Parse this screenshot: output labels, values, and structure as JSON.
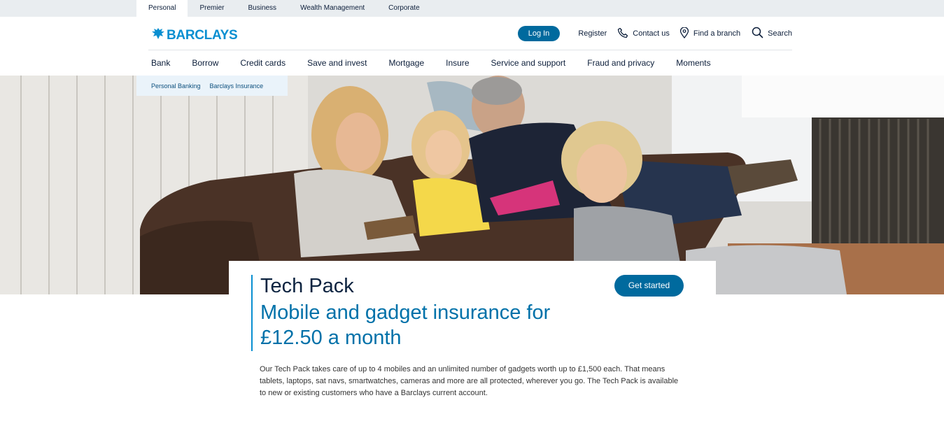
{
  "segments": [
    "Personal",
    "Premier",
    "Business",
    "Wealth Management",
    "Corporate"
  ],
  "brand": {
    "name": "BARCLAYS",
    "logo_icon": "eagle-icon",
    "color": "#0a8fd1"
  },
  "header": {
    "login_label": "Log In",
    "register_label": "Register",
    "contact_label": "Contact us",
    "branch_label": "Find a branch",
    "search_label": "Search"
  },
  "nav": [
    "Bank",
    "Borrow",
    "Credit cards",
    "Save and invest",
    "Mortgage",
    "Insure",
    "Service and support",
    "Fraud and privacy",
    "Moments"
  ],
  "subnav": [
    "Personal Banking",
    "Barclays Insurance"
  ],
  "hero": {
    "title": "Tech Pack",
    "subtitle": "Mobile and gadget insurance for £12.50 a month",
    "cta_label": "Get started",
    "body": "Our Tech Pack takes care of up to 4 mobiles and an unlimited number of gadgets worth up to £1,500 each. That means tablets, laptops, sat navs, smartwatches, cameras and more are all protected, wherever you go. The Tech Pack is available to new or existing customers who have a Barclays current account."
  },
  "colors": {
    "accent": "#006a9e",
    "brand_blue": "#0a8fd1",
    "nav_text": "#0c1e3a"
  }
}
